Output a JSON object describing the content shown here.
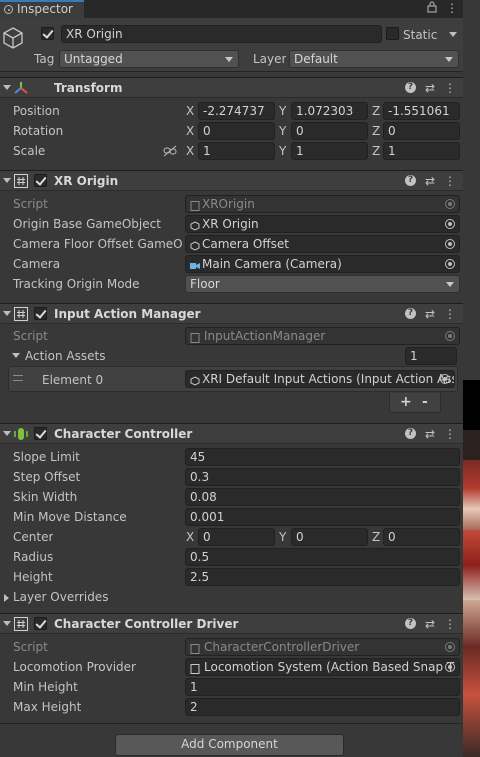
{
  "tab": {
    "label": "Inspector"
  },
  "header": {
    "name": "XR Origin",
    "static_label": "Static",
    "tag_label": "Tag",
    "tag_value": "Untagged",
    "layer_label": "Layer",
    "layer_value": "Default"
  },
  "transform": {
    "title": "Transform",
    "position_label": "Position",
    "rotation_label": "Rotation",
    "scale_label": "Scale",
    "pos": {
      "x": "-2.274737",
      "y": "1.072303",
      "z": "-1.551061"
    },
    "rot": {
      "x": "0",
      "y": "0",
      "z": "0"
    },
    "scale": {
      "x": "1",
      "y": "1",
      "z": "1"
    }
  },
  "axis": {
    "x": "X",
    "y": "Y",
    "z": "Z"
  },
  "xr_origin": {
    "title": "XR Origin",
    "script_label": "Script",
    "script_value": "XROrigin",
    "base_label": "Origin Base GameObject",
    "base_value": "XR Origin",
    "offset_label": "Camera Floor Offset GameObje",
    "offset_value": "Camera Offset",
    "camera_label": "Camera",
    "camera_value": "Main Camera (Camera)",
    "mode_label": "Tracking Origin Mode",
    "mode_value": "Floor"
  },
  "iam": {
    "title": "Input Action Manager",
    "script_label": "Script",
    "script_value": "InputActionManager",
    "assets_label": "Action Assets",
    "assets_count": "1",
    "element_label": "Element 0",
    "element_value": "XRI Default Input Actions (Input Action Ass",
    "plus": "+",
    "minus": "-"
  },
  "cc": {
    "title": "Character Controller",
    "slope_label": "Slope Limit",
    "slope_value": "45",
    "step_label": "Step Offset",
    "step_value": "0.3",
    "skin_label": "Skin Width",
    "skin_value": "0.08",
    "minmove_label": "Min Move Distance",
    "minmove_value": "0.001",
    "center_label": "Center",
    "center": {
      "x": "0",
      "y": "0",
      "z": "0"
    },
    "radius_label": "Radius",
    "radius_value": "0.5",
    "height_label": "Height",
    "height_value": "2.5",
    "layer_overrides": "Layer Overrides"
  },
  "ccd": {
    "title": "Character Controller Driver",
    "script_label": "Script",
    "script_value": "CharacterControllerDriver",
    "loco_label": "Locomotion Provider",
    "loco_value": "Locomotion System (Action Based Snap T",
    "minh_label": "Min Height",
    "minh_value": "1",
    "maxh_label": "Max Height",
    "maxh_value": "2"
  },
  "add_component": "Add Component",
  "colors": {
    "accent": "#3a79bb",
    "panel": "#383838",
    "header": "#3e3e3e",
    "field": "#2a2a2a"
  }
}
